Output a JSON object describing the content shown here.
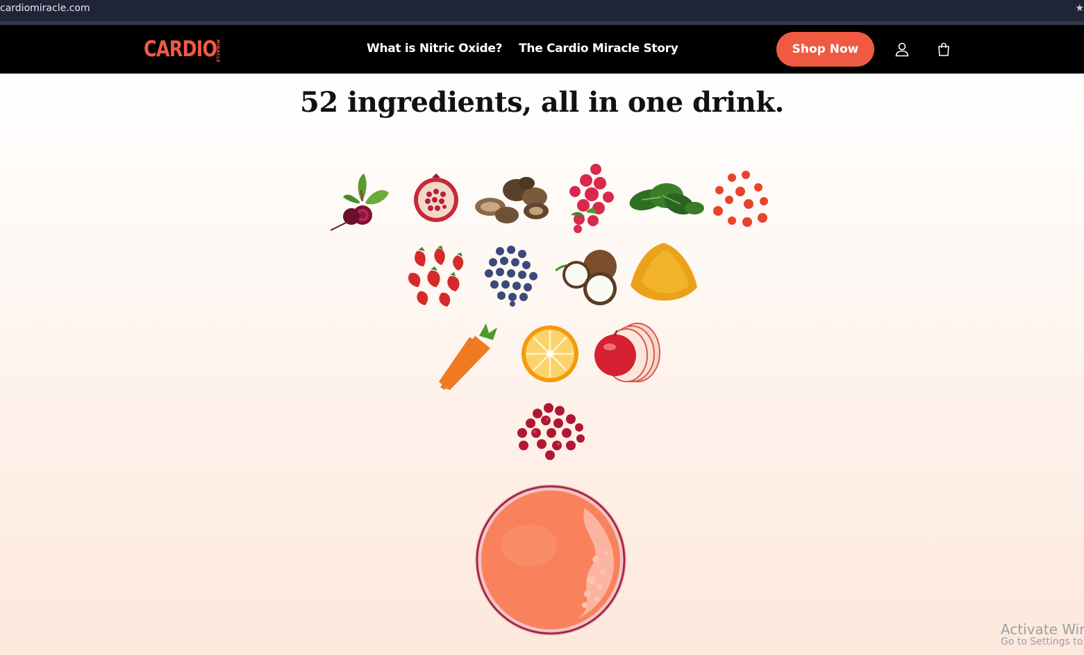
{
  "browser": {
    "url": "cardiomiracle.com",
    "star_icon": "star-icon"
  },
  "header": {
    "logo_text": "CARDIO",
    "logo_subtext": "MIRACLE",
    "nav": [
      {
        "label": "What is Nitric Oxide?"
      },
      {
        "label": "The Cardio Miracle Story"
      }
    ],
    "shop_label": "Shop Now",
    "account_icon": "user-icon",
    "cart_icon": "cart-icon",
    "brand_color": "#f05a43"
  },
  "main": {
    "headline": "52 ingredients, all in one drink.",
    "ingredients": [
      "beet",
      "pomegranate",
      "mushrooms",
      "raspberries",
      "spinach",
      "acerola-cherries",
      "strawberries",
      "blueberries",
      "coconut",
      "turmeric",
      "carrots",
      "orange",
      "apple",
      "cranberries"
    ],
    "drink": "juice-glass"
  },
  "watermark": {
    "line1": "Activate Wind",
    "line2": "Go to Settings to a"
  }
}
